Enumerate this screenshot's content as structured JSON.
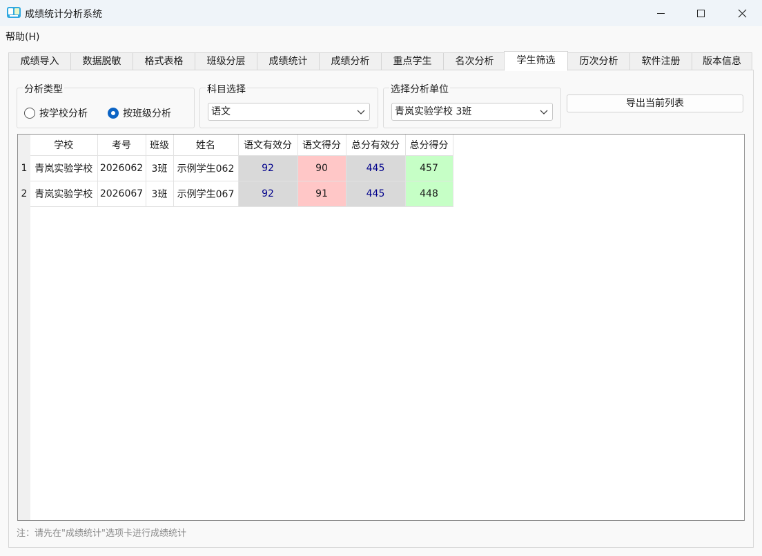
{
  "window": {
    "title": "成绩统计分析系统"
  },
  "menu": {
    "help": "帮助(H)"
  },
  "tabs": [
    {
      "label": "成绩导入",
      "active": false
    },
    {
      "label": "数据脱敏",
      "active": false
    },
    {
      "label": "格式表格",
      "active": false
    },
    {
      "label": "班级分层",
      "active": false
    },
    {
      "label": "成绩统计",
      "active": false
    },
    {
      "label": "成绩分析",
      "active": false
    },
    {
      "label": "重点学生",
      "active": false
    },
    {
      "label": "名次分析",
      "active": false
    },
    {
      "label": "学生筛选",
      "active": true
    },
    {
      "label": "历次分析",
      "active": false
    },
    {
      "label": "软件注册",
      "active": false
    },
    {
      "label": "版本信息",
      "active": false
    }
  ],
  "analysis_type": {
    "legend": "分析类型",
    "options": [
      "按学校分析",
      "按班级分析"
    ],
    "selected": "按班级分析"
  },
  "subject": {
    "legend": "科目选择",
    "value": "语文"
  },
  "unit": {
    "legend": "选择分析单位",
    "value": "青岚实验学校 3班"
  },
  "export_button": "导出当前列表",
  "table": {
    "headers": [
      "学校",
      "考号",
      "班级",
      "姓名",
      "语文有效分",
      "语文得分",
      "总分有效分",
      "总分得分"
    ],
    "rows": [
      {
        "num": "1",
        "cells": [
          "青岚实验学校",
          "2026062",
          "3班",
          "示例学生062",
          "92",
          "90",
          "445",
          "457"
        ]
      },
      {
        "num": "2",
        "cells": [
          "青岚实验学校",
          "2026067",
          "3班",
          "示例学生067",
          "92",
          "91",
          "445",
          "448"
        ]
      }
    ],
    "colors": {
      "effective": "#d9d9d9",
      "below": "#ffc7c7",
      "above": "#c6ffc6"
    }
  },
  "note": "注：请先在\"成绩统计\"选项卡进行成绩统计"
}
